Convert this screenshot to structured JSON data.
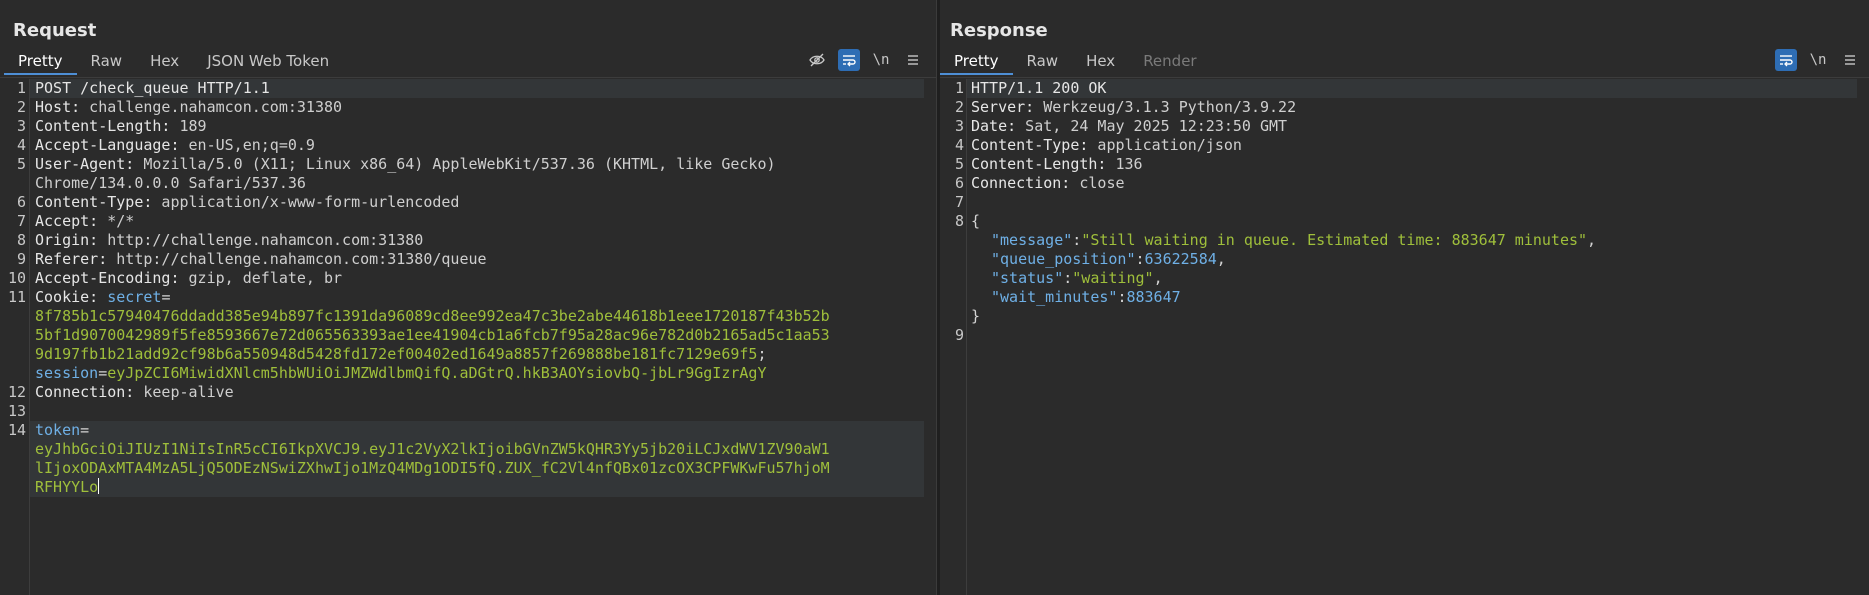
{
  "layout_toggle": [
    "split-horizontal-icon",
    "split-vertical-icon",
    "single-pane-icon"
  ],
  "request": {
    "title": "Request",
    "tabs": [
      "Pretty",
      "Raw",
      "Hex",
      "JSON Web Token"
    ],
    "lines": {
      "l1": "POST /check_queue HTTP/1.1",
      "l2k": "Host:",
      "l2v": " challenge.nahamcon.com:31380",
      "l3k": "Content-Length:",
      "l3v": " 189",
      "l4k": "Accept-Language:",
      "l4v": " en-US,en;q=0.9",
      "l5k": "User-Agent:",
      "l5v": " Mozilla/5.0 (X11; Linux x86_64) AppleWebKit/537.36 (KHTML, like Gecko)",
      "l5c": "Chrome/134.0.0.0 Safari/537.36",
      "l6k": "Content-Type:",
      "l6v": " application/x-www-form-urlencoded",
      "l7k": "Accept:",
      "l7v": " */*",
      "l8k": "Origin:",
      "l8v": " http://challenge.nahamcon.com:31380",
      "l9k": "Referer:",
      "l9v": " http://challenge.nahamcon.com:31380/queue",
      "l10k": "Accept-Encoding:",
      "l10v": " gzip, deflate, br",
      "l11k": "Cookie:",
      "l11n": " secret",
      "l11e": "=",
      "l11a": "8f785b1c57940476ddadd385e94b897fc1391da96089cd8ee992ea47c3be2abe44618b1eee1720187f43b52b",
      "l11b": "5bf1d9070042989f5fe8593667e72d065563393ae1ee41904cb1a6fcb7f95a28ac96e782d0b2165ad5c1aa53",
      "l11c": "9d197fb1b21add92cf98b6a550948d5428fd172ef00402ed1649a8857f269888be181fc7129e69f5",
      "l11semi": ";",
      "l11s": "session",
      "l11se": "=",
      "l11sv": "eyJpZCI6MiwidXNlcm5hbWUiOiJMZWdlbmQifQ.aDGtrQ.hkB3AOYsiovbQ-jbLr9GgIzrAgY",
      "l12k": "Connection:",
      "l12v": " keep-alive",
      "l14n": "token",
      "l14e": "=",
      "l14a": "eyJhbGciOiJIUzI1NiIsInR5cCI6IkpXVCJ9.eyJ1c2VyX2lkIjoibGVnZW5kQHR3Yy5jb20iLCJxdWV1ZV90aW1",
      "l14b": "lIjoxODAxMTA4MzA5LjQ5ODEzNSwiZXhwIjo1MzQ4MDg1ODI5fQ.ZUX_fC2Vl4nfQBx01zcOX3CPFWKwFu57hjoM",
      "l14c": "RFHYYLo"
    },
    "line_numbers": [
      "1",
      "2",
      "3",
      "4",
      "5",
      "6",
      "7",
      "8",
      "9",
      "10",
      "11",
      "12",
      "13",
      "14"
    ]
  },
  "response": {
    "title": "Response",
    "tabs": [
      "Pretty",
      "Raw",
      "Hex",
      "Render"
    ],
    "lines": {
      "l1": "HTTP/1.1 200 OK",
      "l2k": "Server:",
      "l2v": " Werkzeug/3.1.3 Python/3.9.22",
      "l3k": "Date:",
      "l3v": " Sat, 24 May 2025 12:23:50 GMT",
      "l4k": "Content-Type:",
      "l4v": " application/json",
      "l5k": "Content-Length:",
      "l5v": " 136",
      "l6k": "Connection:",
      "l6v": " close",
      "l8": "{",
      "j1k": "\"message\"",
      "j1v": "\"Still waiting in queue. Estimated time: 883647 minutes\"",
      "j2k": "\"queue_position\"",
      "j2v": "63622584",
      "j3k": "\"status\"",
      "j3v": "\"waiting\"",
      "j4k": "\"wait_minutes\"",
      "j4v": "883647",
      "close": "}",
      "colon": ":",
      "comma": ","
    },
    "line_numbers": [
      "1",
      "2",
      "3",
      "4",
      "5",
      "6",
      "7",
      "8",
      "9"
    ]
  },
  "tools": {
    "newline_label": "\\n"
  }
}
